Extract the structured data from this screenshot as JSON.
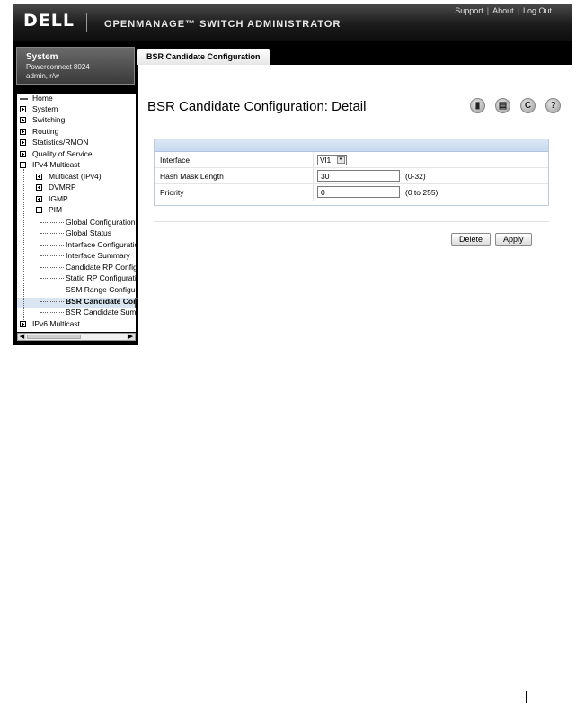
{
  "header": {
    "logo": "DELL",
    "product": "OPENMANAGE™ SWITCH ADMINISTRATOR",
    "links": [
      "Support",
      "About",
      "Log Out"
    ]
  },
  "system": {
    "title": "System",
    "model": "Powerconnect 8024",
    "user": "admin, r/w"
  },
  "tree": {
    "home": "Home",
    "system": "System",
    "switching": "Switching",
    "routing": "Routing",
    "statistics": "Statistics/RMON",
    "qos": "Quality of Service",
    "ipv4": "IPv4 Multicast",
    "multicast": "Multicast (IPv4)",
    "dvmrp": "DVMRP",
    "igmp": "IGMP",
    "pim": "PIM",
    "pim_items": [
      "Global Configuration",
      "Global Status",
      "Interface Configuration",
      "Interface Summary",
      "Candidate RP Configuration",
      "Static RP Configuration",
      "SSM Range Configuration",
      "BSR Candidate Configuration",
      "BSR Candidate Summary"
    ],
    "ipv6": "IPv6 Multicast"
  },
  "tab": {
    "label": "BSR Candidate Configuration"
  },
  "page": {
    "title": "BSR Candidate Configuration: Detail"
  },
  "form": {
    "interface_label": "Interface",
    "interface_value": "Vl1",
    "hash_label": "Hash Mask Length",
    "hash_value": "30",
    "hash_hint": "(0-32)",
    "priority_label": "Priority",
    "priority_value": "0",
    "priority_hint": "(0 to 255)"
  },
  "buttons": {
    "delete": "Delete",
    "apply": "Apply"
  },
  "icons": {
    "save": "save-icon",
    "print": "print-icon",
    "refresh": "refresh-icon",
    "help": "help-icon"
  }
}
